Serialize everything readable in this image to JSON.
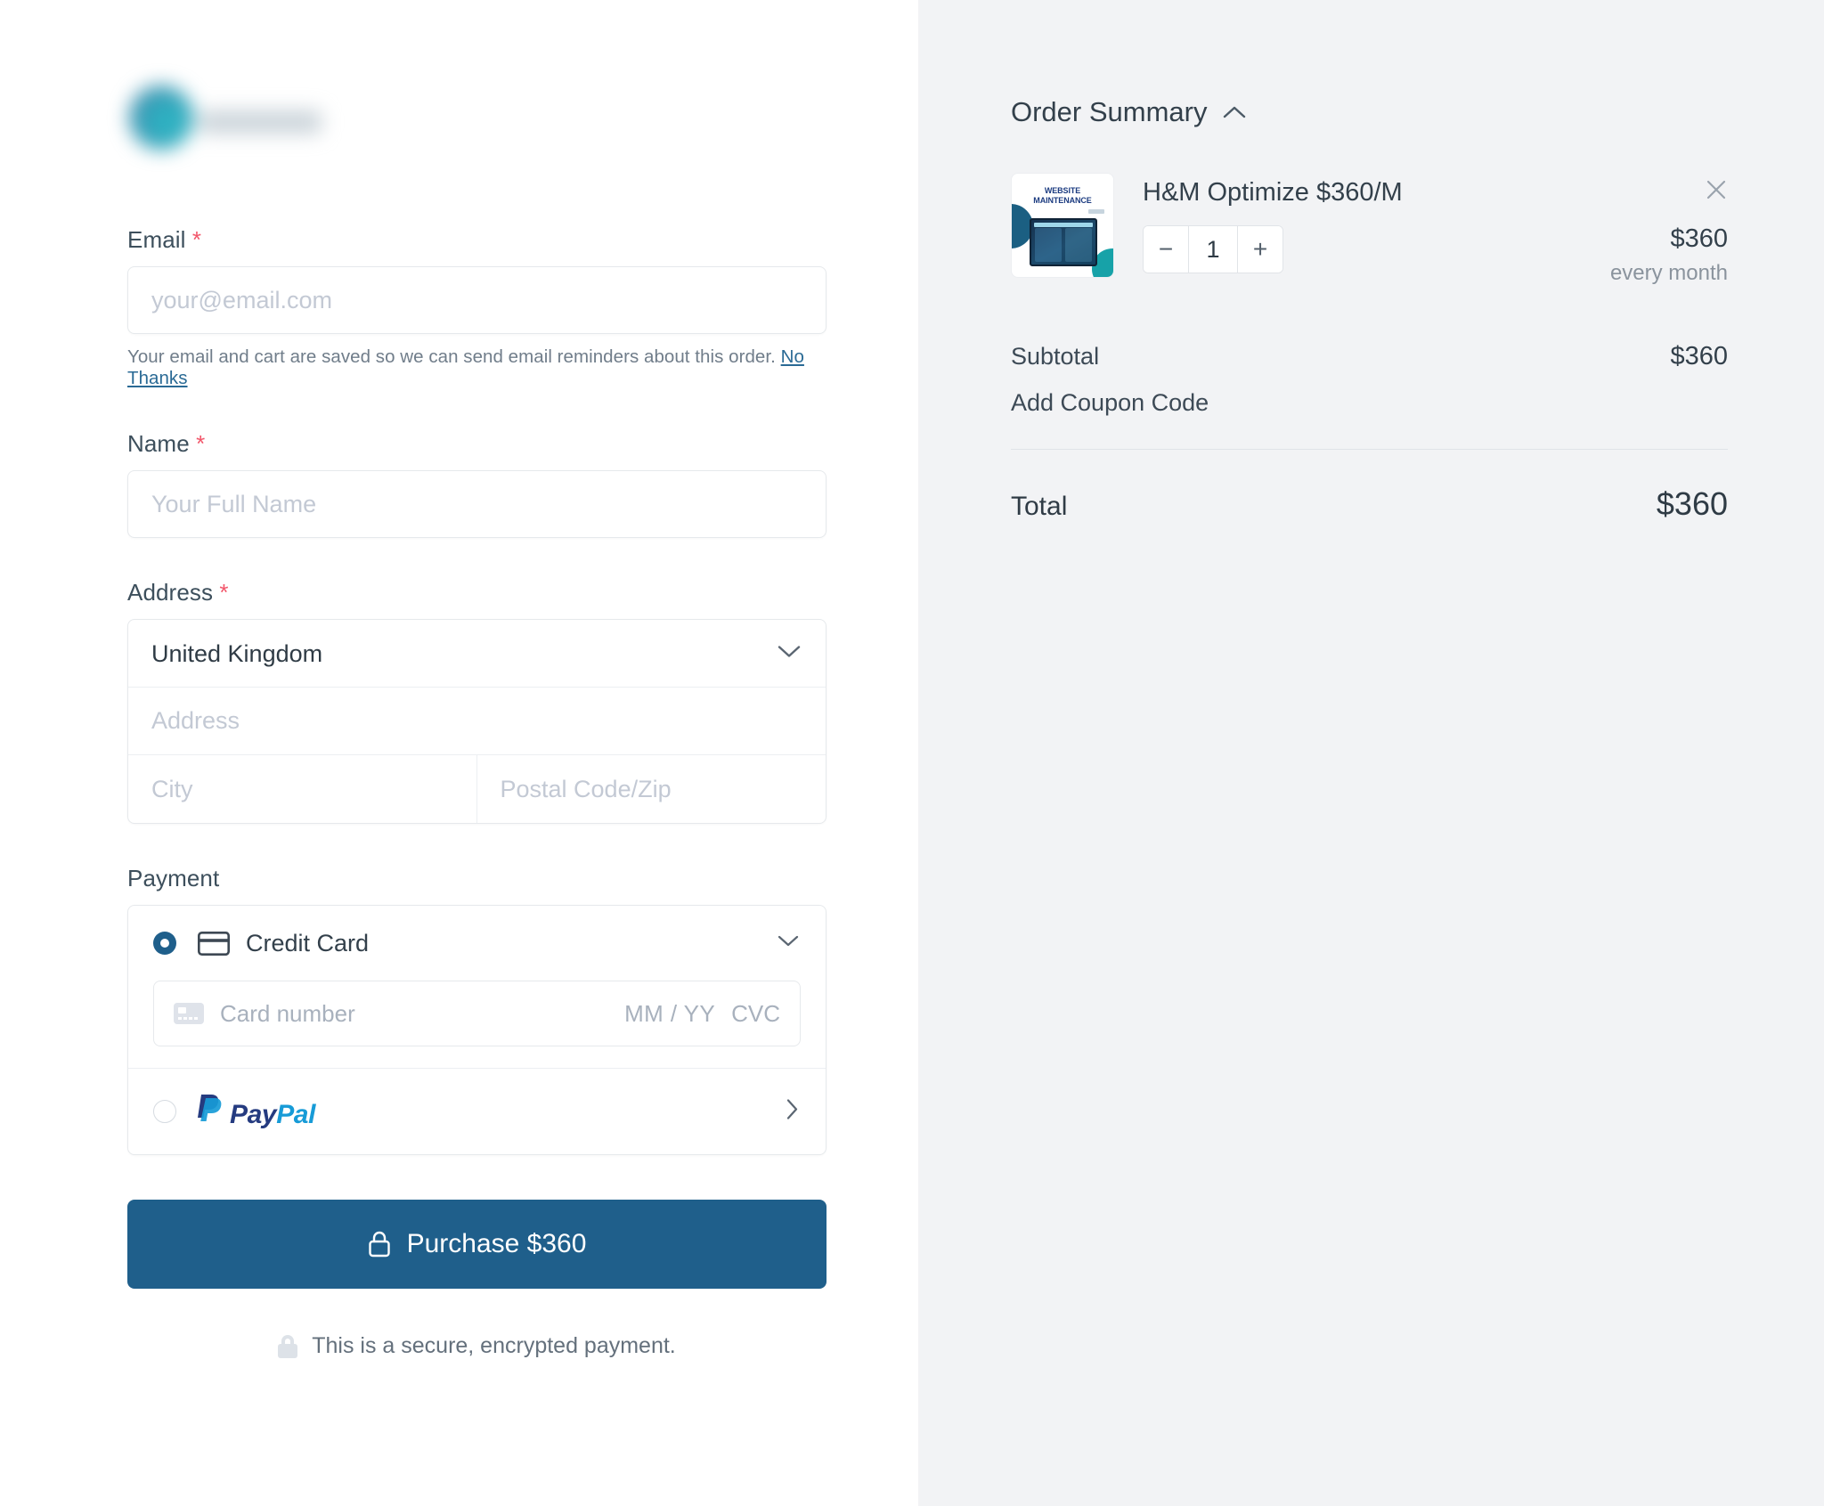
{
  "brand": {
    "logo_alt": "company-logo",
    "logo_mark_color": "#2fa8bd"
  },
  "form": {
    "email": {
      "label": "Email",
      "required_mark": "*",
      "placeholder": "your@email.com",
      "value": "",
      "help_text": "Your email and cart are saved so we can send email reminders about this order.",
      "help_link": "No Thanks"
    },
    "name": {
      "label": "Name",
      "required_mark": "*",
      "placeholder": "Your Full Name",
      "value": ""
    },
    "address": {
      "label": "Address",
      "required_mark": "*",
      "country_selected": "United Kingdom",
      "country_options": [
        "United Kingdom"
      ],
      "street_placeholder": "Address",
      "city_placeholder": "City",
      "postal_placeholder": "Postal Code/Zip",
      "street_value": "",
      "city_value": "",
      "postal_value": ""
    },
    "payment": {
      "label": "Payment",
      "methods": [
        {
          "id": "credit-card",
          "label": "Credit Card",
          "selected": true
        },
        {
          "id": "paypal",
          "label_part1": "Pay",
          "label_part2": "Pal",
          "selected": false
        }
      ],
      "card": {
        "number_placeholder": "Card number",
        "expiry_placeholder": "MM / YY",
        "cvc_placeholder": "CVC",
        "number_value": ""
      }
    },
    "purchase_button": "Purchase $360",
    "secure_note": "This is a secure, encrypted payment."
  },
  "summary": {
    "title": "Order Summary",
    "collapse_state": "expanded",
    "item": {
      "thumb_title_line1": "WEBSITE",
      "thumb_title_line2": "MAINTENANCE",
      "name": "H&M Optimize $360/M",
      "quantity": "1",
      "decrement_label": "−",
      "increment_label": "+",
      "price": "$360",
      "billing_cycle": "every month"
    },
    "subtotal_label": "Subtotal",
    "subtotal_value": "$360",
    "coupon_label": "Add Coupon Code",
    "total_label": "Total",
    "total_value": "$360"
  },
  "colors": {
    "primary": "#1f5f8b",
    "panel_bg": "#f2f3f5",
    "required": "#f2566a",
    "link": "#2a6a95",
    "paypal_dark": "#253b80",
    "paypal_light": "#179bd7"
  }
}
